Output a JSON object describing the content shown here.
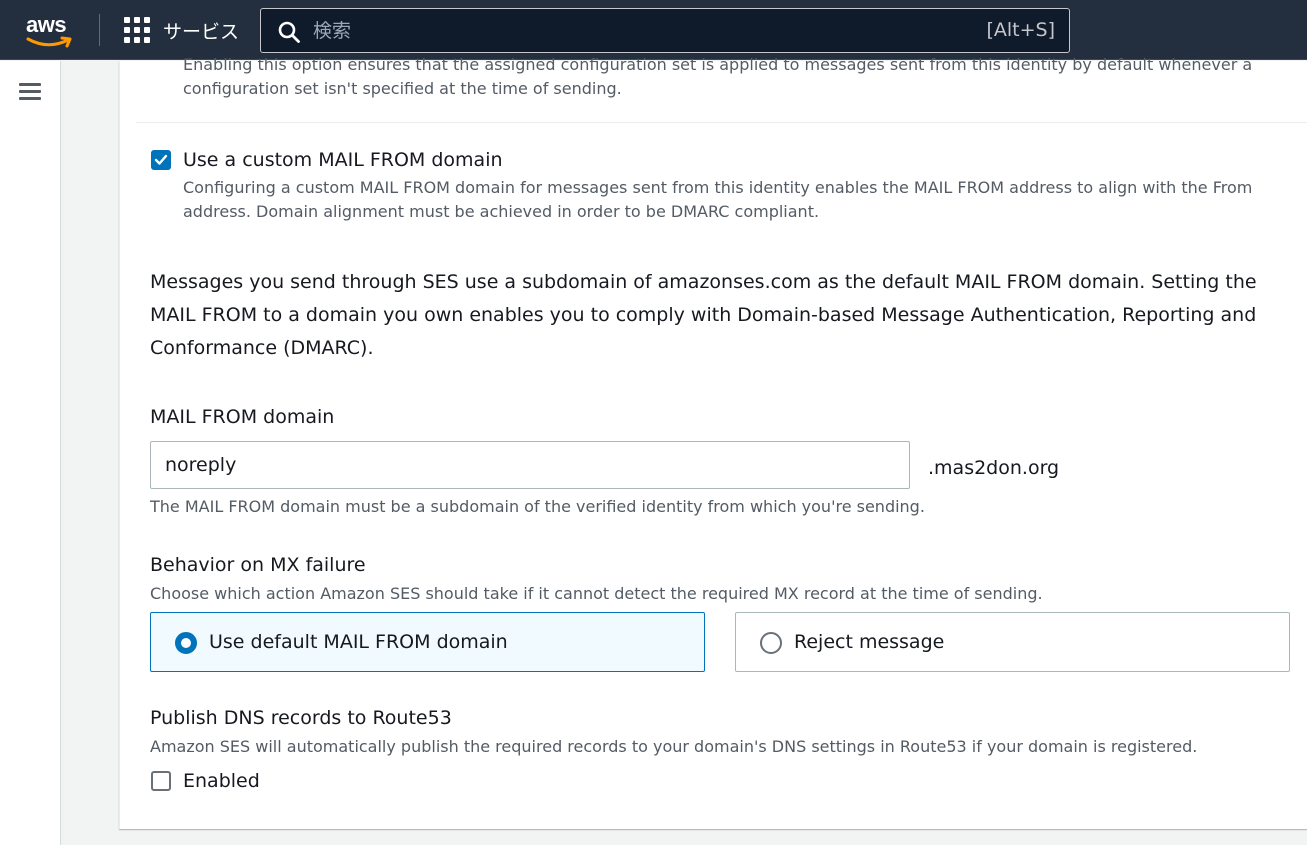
{
  "topbar": {
    "logo_text": "aws",
    "services_label": "サービス",
    "search_placeholder": "検索",
    "search_shortcut": "[Alt+S]"
  },
  "config_set": {
    "description": "Enabling this option ensures that the assigned configuration set is applied to messages sent from this identity by default whenever a configuration set isn't specified at the time of sending."
  },
  "custom_mail_from": {
    "checked": true,
    "label": "Use a custom MAIL FROM domain",
    "description": "Configuring a custom MAIL FROM domain for messages sent from this identity enables the MAIL FROM address to align with the From address. Domain alignment must be achieved in order to be DMARC compliant."
  },
  "intro_text": "Messages you send through SES use a subdomain of amazonses.com as the default MAIL FROM domain. Setting the MAIL FROM to a domain you own enables you to comply with Domain-based Message Authentication, Reporting and Conformance (DMARC).",
  "mail_from_domain": {
    "label": "MAIL FROM domain",
    "value": "noreply",
    "suffix": ".mas2don.org",
    "hint": "The MAIL FROM domain must be a subdomain of the verified identity from which you're sending."
  },
  "mx_failure": {
    "label": "Behavior on MX failure",
    "description": "Choose which action Amazon SES should take if it cannot detect the required MX record at the time of sending.",
    "options": [
      {
        "label": "Use default MAIL FROM domain",
        "selected": true
      },
      {
        "label": "Reject message",
        "selected": false
      }
    ]
  },
  "publish_dns": {
    "label": "Publish DNS records to Route53",
    "description": "Amazon SES will automatically publish the required records to your domain's DNS settings in Route53 if your domain is registered.",
    "enabled_label": "Enabled",
    "enabled": false
  },
  "colors": {
    "nav_bg": "#232f3e",
    "accent": "#0073bb",
    "aws_smile": "#ff9900"
  }
}
